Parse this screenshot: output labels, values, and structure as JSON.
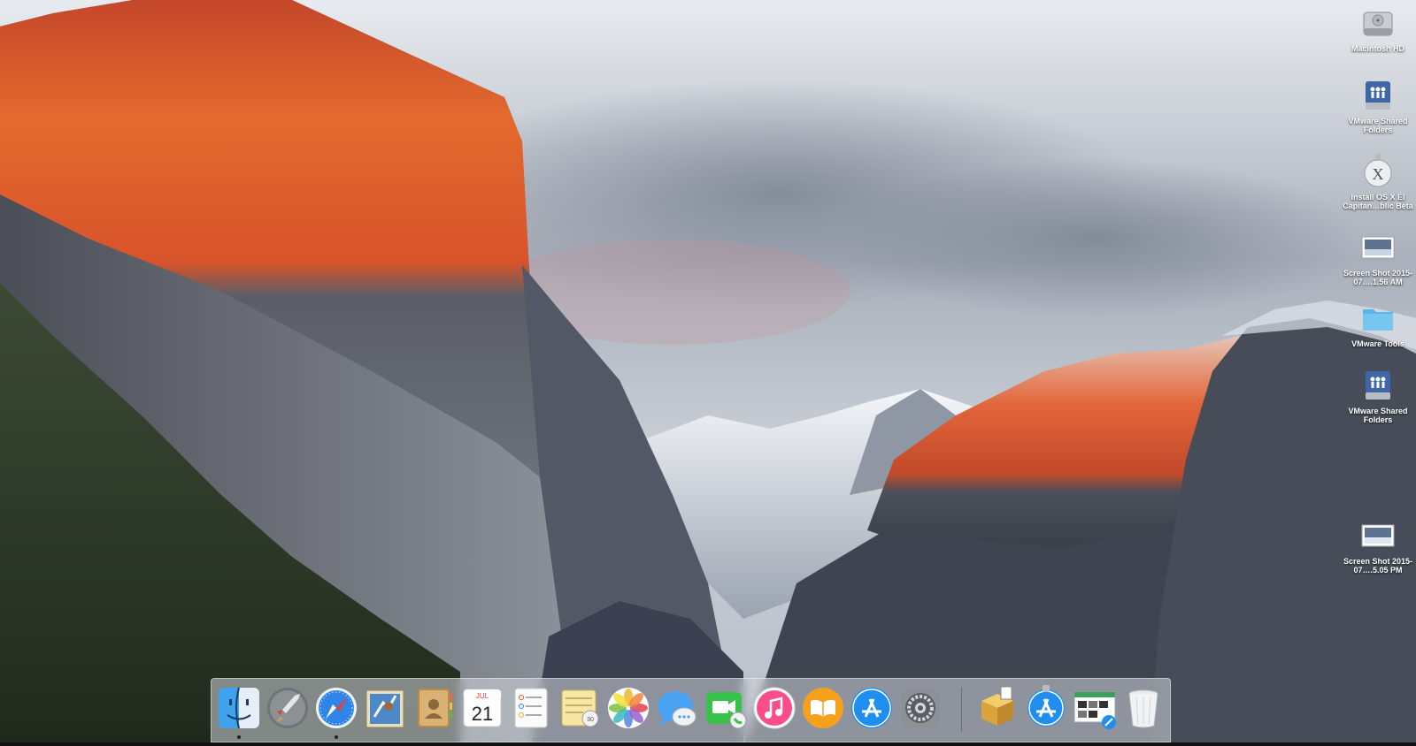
{
  "desktop": {
    "items": [
      {
        "label": "Macintosh HD",
        "icon": "hard-drive-icon"
      },
      {
        "label": "VMware Shared Folders",
        "icon": "shared-folder-drive-icon"
      },
      {
        "label": "Install OS X El Capitan…blic Beta",
        "icon": "os-x-installer-icon"
      },
      {
        "label": "Screen Shot 2015-07….1.56 AM",
        "icon": "screenshot-file-icon"
      },
      {
        "label": "VMware Tools",
        "icon": "folder-icon"
      },
      {
        "label": "VMware Shared Folders",
        "icon": "shared-folder-drive-icon"
      },
      {
        "label": "Screen Shot 2015-07….5.05 PM",
        "icon": "screenshot-file-icon"
      }
    ]
  },
  "dock": {
    "apps": [
      {
        "icon": "finder-icon"
      },
      {
        "icon": "launchpad-icon"
      },
      {
        "icon": "safari-icon"
      },
      {
        "icon": "mail-icon"
      },
      {
        "icon": "contacts-icon"
      },
      {
        "icon": "calendar-icon",
        "month": "JUL",
        "day": "21"
      },
      {
        "icon": "reminders-icon"
      },
      {
        "icon": "notes-icon"
      },
      {
        "icon": "photos-icon"
      },
      {
        "icon": "messages-icon"
      },
      {
        "icon": "facetime-icon"
      },
      {
        "icon": "itunes-icon"
      },
      {
        "icon": "ibooks-icon"
      },
      {
        "icon": "app-store-icon"
      },
      {
        "icon": "system-preferences-icon"
      }
    ],
    "others": [
      {
        "icon": "installer-package-icon"
      },
      {
        "icon": "app-store-download-icon"
      },
      {
        "icon": "web-document-icon"
      },
      {
        "icon": "trash-icon"
      }
    ]
  },
  "colors": {
    "dock_bg": "#d2d6dc",
    "label_text": "#ffffff",
    "cliff_orange": "#e0532a",
    "sky": "#d8dde4"
  }
}
